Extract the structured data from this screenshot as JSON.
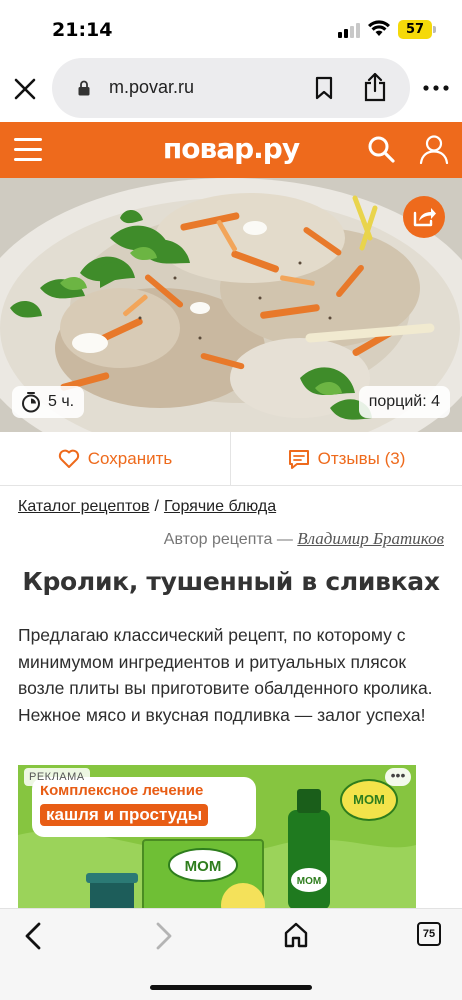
{
  "status_bar": {
    "time": "21:14",
    "battery": "57",
    "signal_bars_active": 2,
    "signal_bars_total": 4
  },
  "browser": {
    "url": "m.povar.ru",
    "tabs_count": "75"
  },
  "site": {
    "logo": "повар.ру",
    "brand_color": "#ee6a1c"
  },
  "recipe": {
    "cook_time": "5 ч.",
    "portions": "порций: 4",
    "save_label": "Сохранить",
    "reviews_label": "Отзывы (3)",
    "breadcrumb": [
      "Каталог рецептов",
      "Горячие блюда"
    ],
    "breadcrumb_separator": "/",
    "author_prefix": "Автор рецепта —",
    "author_name": "Владимир Братиков",
    "title": "Кролик, тушенный в сливках",
    "description": "Предлагаю классический рецепт, по которому с минимумом ингредиентов и ритуальных плясок возле плиты вы приготовите обалденного кролика. Нежное мясо и вкусная подливка — залог успеха!"
  },
  "ad": {
    "label": "РЕКЛАМА",
    "more": "•••",
    "line1": "Комплексное лечение",
    "line2": "кашля и простуды",
    "brand": "МОМ"
  }
}
